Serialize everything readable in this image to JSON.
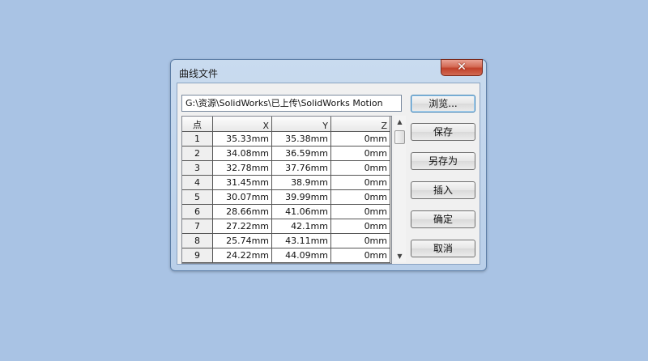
{
  "dialog": {
    "title": "曲线文件",
    "close_label": "✕",
    "path_value": "G:\\资源\\SolidWorks\\已上传\\SolidWorks Motion",
    "buttons": {
      "browse": "浏览...",
      "save": "保存",
      "save_as": "另存为",
      "insert": "插入",
      "ok": "确定",
      "cancel": "取消"
    },
    "table": {
      "headers": [
        "点",
        "X",
        "Y",
        "Z"
      ],
      "rows": [
        [
          "1",
          "35.33mm",
          "35.38mm",
          "0mm"
        ],
        [
          "2",
          "34.08mm",
          "36.59mm",
          "0mm"
        ],
        [
          "3",
          "32.78mm",
          "37.76mm",
          "0mm"
        ],
        [
          "4",
          "31.45mm",
          "38.9mm",
          "0mm"
        ],
        [
          "5",
          "30.07mm",
          "39.99mm",
          "0mm"
        ],
        [
          "6",
          "28.66mm",
          "41.06mm",
          "0mm"
        ],
        [
          "7",
          "27.22mm",
          "42.1mm",
          "0mm"
        ],
        [
          "8",
          "25.74mm",
          "43.11mm",
          "0mm"
        ],
        [
          "9",
          "24.22mm",
          "44.09mm",
          "0mm"
        ]
      ]
    },
    "scroll_up": "▲",
    "scroll_down": "▼"
  }
}
